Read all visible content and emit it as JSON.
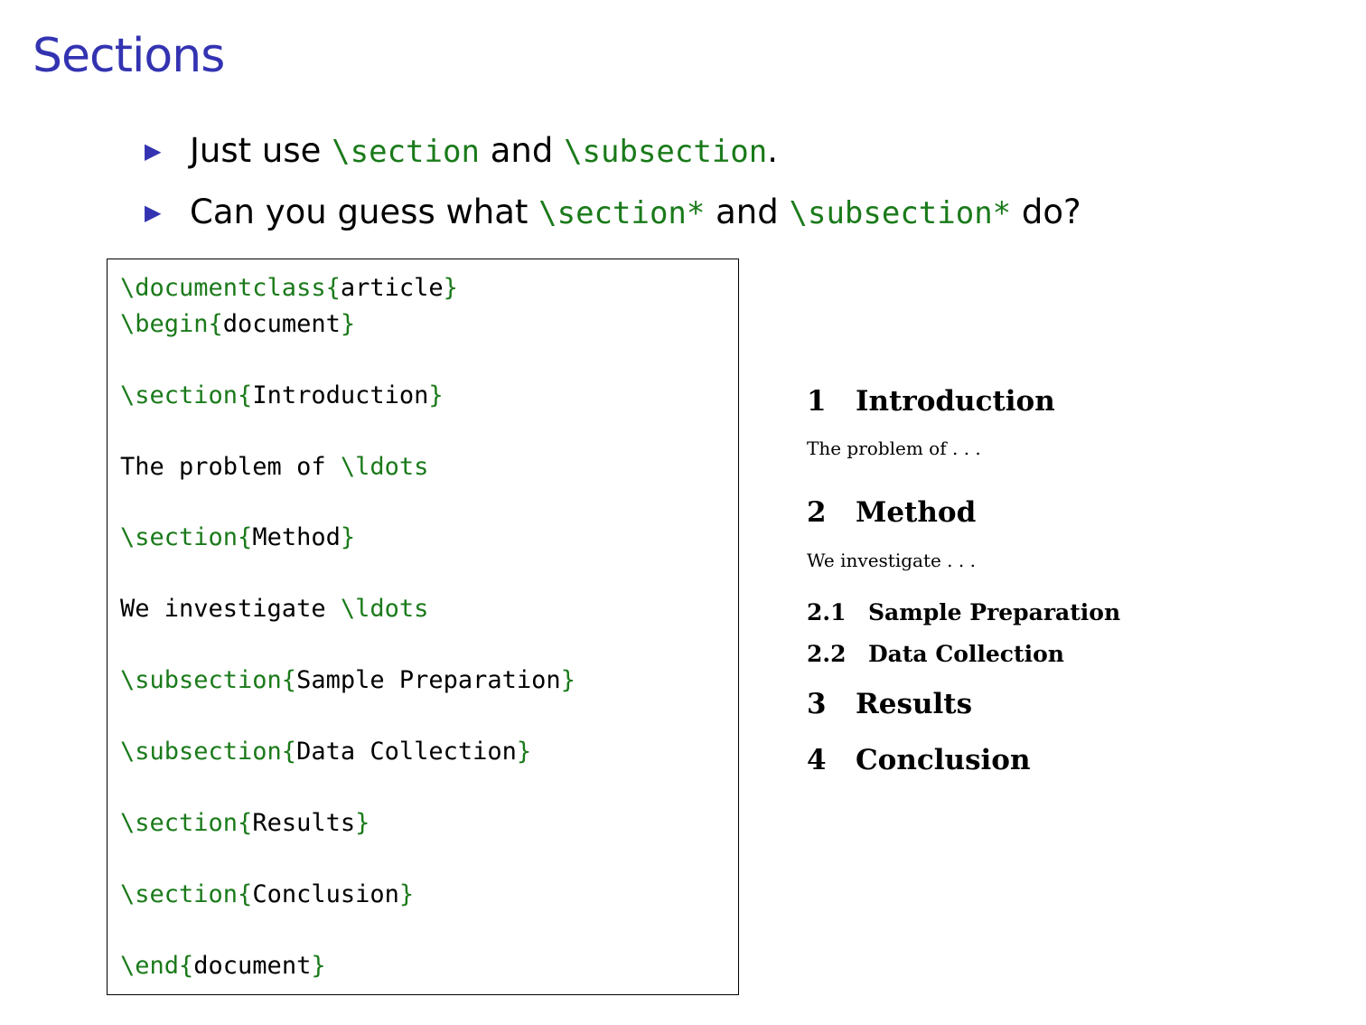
{
  "title": "Sections",
  "bullets": [
    {
      "parts": [
        {
          "text": "Just use ",
          "code": false
        },
        {
          "text": "\\section",
          "code": true
        },
        {
          "text": " and ",
          "code": false
        },
        {
          "text": "\\subsection",
          "code": true
        },
        {
          "text": ".",
          "code": false
        }
      ]
    },
    {
      "parts": [
        {
          "text": "Can you guess what ",
          "code": false
        },
        {
          "text": "\\section*",
          "code": true
        },
        {
          "text": " and ",
          "code": false
        },
        {
          "text": "\\subsection*",
          "code": true
        },
        {
          "text": " do?",
          "code": false
        }
      ]
    }
  ],
  "code": [
    [
      {
        "t": "\\documentclass{",
        "c": "cmd"
      },
      {
        "t": "article",
        "c": "txt"
      },
      {
        "t": "}",
        "c": "cmd"
      }
    ],
    [
      {
        "t": "\\begin{",
        "c": "cmd"
      },
      {
        "t": "document",
        "c": "txt"
      },
      {
        "t": "}",
        "c": "cmd"
      }
    ],
    [
      {
        "t": "\\section{",
        "c": "cmd"
      },
      {
        "t": "Introduction",
        "c": "txt"
      },
      {
        "t": "}",
        "c": "cmd"
      }
    ],
    [
      {
        "t": "The problem of ",
        "c": "txt"
      },
      {
        "t": "\\ldots",
        "c": "cmd"
      }
    ],
    [
      {
        "t": "\\section{",
        "c": "cmd"
      },
      {
        "t": "Method",
        "c": "txt"
      },
      {
        "t": "}",
        "c": "cmd"
      }
    ],
    [
      {
        "t": "We investigate ",
        "c": "txt"
      },
      {
        "t": "\\ldots",
        "c": "cmd"
      }
    ],
    [
      {
        "t": "\\subsection{",
        "c": "cmd"
      },
      {
        "t": "Sample Preparation",
        "c": "txt"
      },
      {
        "t": "}",
        "c": "cmd"
      }
    ],
    [
      {
        "t": "\\subsection{",
        "c": "cmd"
      },
      {
        "t": "Data Collection",
        "c": "txt"
      },
      {
        "t": "}",
        "c": "cmd"
      }
    ],
    [
      {
        "t": "\\section{",
        "c": "cmd"
      },
      {
        "t": "Results",
        "c": "txt"
      },
      {
        "t": "}",
        "c": "cmd"
      }
    ],
    [
      {
        "t": "\\section{",
        "c": "cmd"
      },
      {
        "t": "Conclusion",
        "c": "txt"
      },
      {
        "t": "}",
        "c": "cmd"
      }
    ],
    [
      {
        "t": "\\end{",
        "c": "cmd"
      },
      {
        "t": "document",
        "c": "txt"
      },
      {
        "t": "}",
        "c": "cmd"
      }
    ]
  ],
  "preview": [
    {
      "kind": "section",
      "num": "1",
      "text": "Introduction"
    },
    {
      "kind": "para",
      "text": "The problem of . . ."
    },
    {
      "kind": "section",
      "num": "2",
      "text": "Method"
    },
    {
      "kind": "para",
      "text": "We investigate . . ."
    },
    {
      "kind": "subsection",
      "num": "2.1",
      "text": "Sample Preparation"
    },
    {
      "kind": "subsection",
      "num": "2.2",
      "text": "Data Collection"
    },
    {
      "kind": "section",
      "num": "3",
      "text": "Results"
    },
    {
      "kind": "section",
      "num": "4",
      "text": "Conclusion"
    }
  ],
  "colors": {
    "title": "#3333b2",
    "code_command": "#1a7a1a",
    "bullet_marker": "#3333b2"
  }
}
